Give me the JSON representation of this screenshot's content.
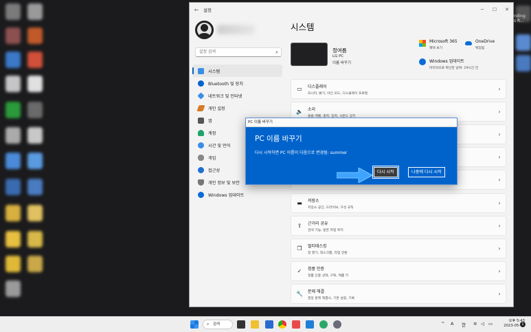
{
  "window": {
    "title": "설정",
    "controls": {
      "minimize": "─",
      "maximize": "☐",
      "close": "✕"
    }
  },
  "sidebar": {
    "search_placeholder": "설정 검색",
    "items": [
      {
        "label": "시스템",
        "icon": "display-icon",
        "color": "#3a8ee6"
      },
      {
        "label": "Bluetooth 및 장치",
        "icon": "bluetooth-icon",
        "color": "#0063cc"
      },
      {
        "label": "네트워크 및 인터넷",
        "icon": "wifi-icon",
        "color": "#3a8ee6"
      },
      {
        "label": "개인 설정",
        "icon": "brush-icon",
        "color": "#d77a28"
      },
      {
        "label": "앱",
        "icon": "apps-icon",
        "color": "#555555"
      },
      {
        "label": "계정",
        "icon": "person-icon",
        "color": "#1fa36a"
      },
      {
        "label": "시간 및 언어",
        "icon": "globe-icon",
        "color": "#3a8ee6"
      },
      {
        "label": "게임",
        "icon": "gamepad-icon",
        "color": "#888888"
      },
      {
        "label": "접근성",
        "icon": "accessibility-icon",
        "color": "#1f6fd1"
      },
      {
        "label": "개인 정보 및 보안",
        "icon": "shield-icon",
        "color": "#777777"
      },
      {
        "label": "Windows 업데이트",
        "icon": "update-icon",
        "color": "#0a6cd6"
      }
    ]
  },
  "main": {
    "title": "시스템",
    "device": {
      "name": "정여름",
      "model": "LG PC",
      "rename": "이름 바꾸기"
    },
    "tiles": [
      {
        "title": "Microsoft 365",
        "sub": "혜택 보기",
        "icon": "microsoft-icon"
      },
      {
        "title": "OneDrive",
        "sub": "백업됨",
        "icon": "cloud-icon"
      },
      {
        "title": "Windows 업데이트",
        "sub": "마지막으로 확인한 날짜: 14시간 전",
        "icon": "update-icon"
      }
    ],
    "cards": [
      {
        "title": "디스플레이",
        "sub": "모니터, 밝기, 야간 모드, 디스플레이 프로필",
        "icon": "monitor-icon",
        "glyph": "▭"
      },
      {
        "title": "소리",
        "sub": "볼륨 레벨, 출력, 입력, 사운드 장치",
        "icon": "speaker-icon",
        "glyph": "🔈"
      },
      {
        "title": "",
        "sub": "",
        "icon": "",
        "glyph": ""
      },
      {
        "title": "",
        "sub": "",
        "icon": "",
        "glyph": ""
      },
      {
        "title": "",
        "sub": "",
        "icon": "",
        "glyph": ""
      },
      {
        "title": "저장소",
        "sub": "저장소 공간, 드라이브, 구성 규칙",
        "icon": "storage-icon",
        "glyph": "▬"
      },
      {
        "title": "근거리 공유",
        "sub": "검색 기능, 받은 파일 위치",
        "icon": "share-icon",
        "glyph": "⇪"
      },
      {
        "title": "멀티태스킹",
        "sub": "창 끌기, 데스크톱, 작업 전환",
        "icon": "multitask-icon",
        "glyph": "❐"
      },
      {
        "title": "정품 인증",
        "sub": "정품 인증 상태, 구독, 제품 키",
        "icon": "check-circle-icon",
        "glyph": "✓"
      },
      {
        "title": "문제 해결",
        "sub": "권장 문제 해결사, 기본 설정, 기록",
        "icon": "wrench-icon",
        "glyph": "🔧"
      }
    ]
  },
  "dialog": {
    "titlebar": "PC 이름 바꾸기",
    "title": "PC 이름 바꾸기",
    "message": "다시 시작하면 PC 이름이 다음으로 변경됨: summer",
    "restart_now": "다시 시작",
    "restart_later": "나중에 다시 시작"
  },
  "desktop_right": [
    "nding",
    "s R..."
  ],
  "taskbar": {
    "search_label": "검색",
    "tray": {
      "chevron": "^",
      "ime_a": "A",
      "ime_han": "한"
    },
    "time": "오후 5:43",
    "date": "2023-05-08",
    "notification_count": "1"
  },
  "colors": {
    "accent": "#0063cc",
    "dialog_bg": "#0063cc",
    "window_bg": "#f3f3f3"
  }
}
